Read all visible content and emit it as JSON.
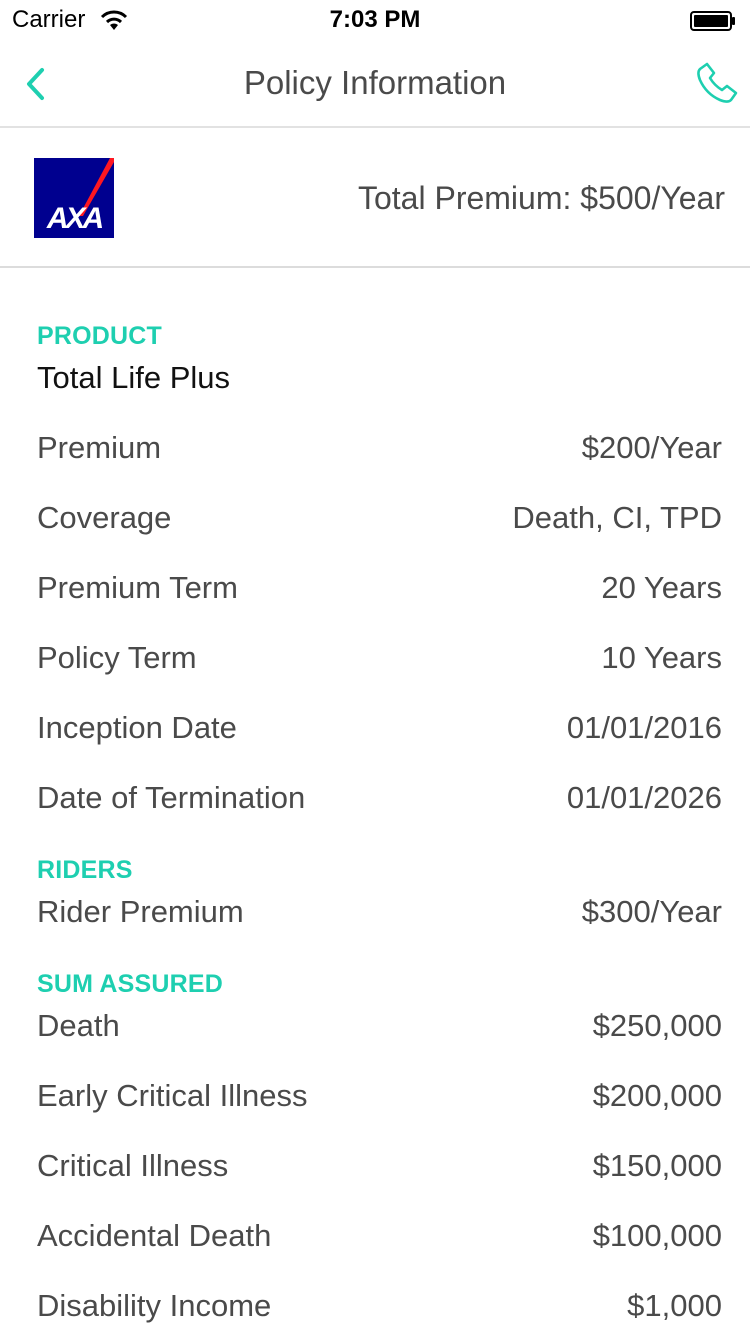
{
  "status_bar": {
    "carrier": "Carrier",
    "time": "7:03 PM"
  },
  "nav": {
    "title": "Policy Information",
    "back_icon": "chevron-left-icon",
    "call_icon": "phone-icon"
  },
  "summary": {
    "logo_text": "AXA",
    "total_premium": "Total Premium: $500/Year"
  },
  "product": {
    "label": "PRODUCT",
    "name": "Total Life Plus",
    "rows": [
      {
        "key": "Premium",
        "value": "$200/Year"
      },
      {
        "key": "Coverage",
        "value": "Death, CI, TPD"
      },
      {
        "key": "Premium Term",
        "value": "20 Years"
      },
      {
        "key": "Policy Term",
        "value": "10 Years"
      },
      {
        "key": "Inception Date",
        "value": "01/01/2016"
      },
      {
        "key": "Date of Termination",
        "value": "01/01/2026"
      }
    ]
  },
  "riders": {
    "label": "RIDERS",
    "rows": [
      {
        "key": "Rider Premium",
        "value": "$300/Year"
      }
    ]
  },
  "sum_assured": {
    "label": "SUM ASSURED",
    "rows": [
      {
        "key": "Death",
        "value": "$250,000"
      },
      {
        "key": "Early Critical Illness",
        "value": "$200,000"
      },
      {
        "key": "Critical Illness",
        "value": "$150,000"
      },
      {
        "key": "Accidental Death",
        "value": "$100,000"
      },
      {
        "key": "Disability Income",
        "value": "$1,000"
      }
    ]
  },
  "colors": {
    "accent": "#1ecfb0",
    "axa_blue": "#00008f",
    "axa_red": "#ff1721"
  }
}
